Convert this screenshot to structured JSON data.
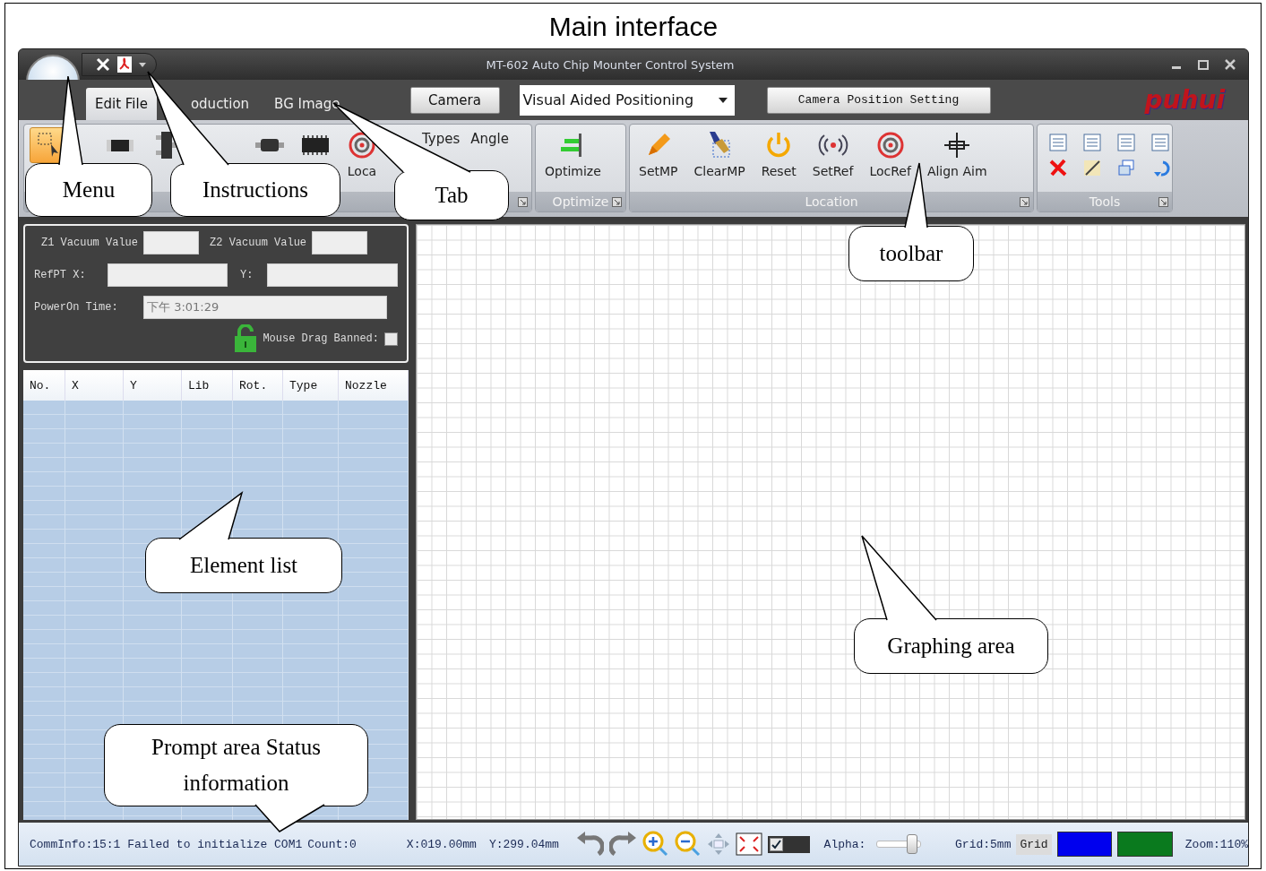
{
  "figure_title": "Main interface",
  "window": {
    "title": "MT-602 Auto Chip Mounter Control System"
  },
  "tabs": [
    {
      "label": "Edit File",
      "selected": true
    },
    {
      "label": "oduction",
      "selected": false
    },
    {
      "label": "BG Image",
      "selected": false
    }
  ],
  "tab_bar": {
    "camera_button": "Camera",
    "mode_select": "Visual Aided Positioning",
    "camera_position_button": "Camera Position Setting",
    "logo": "puhui"
  },
  "ribbon": [
    {
      "kind": "parts",
      "items": [
        {
          "kind": "select",
          "selected": true
        },
        {
          "kind": "chip",
          "selected": false
        },
        {
          "kind": "transistor",
          "selected": false
        },
        {
          "kind": "diode",
          "selected": false
        },
        {
          "kind": "ic",
          "selected": false
        },
        {
          "kind": "target",
          "label": "Loca",
          "selected": false
        }
      ],
      "fields": [
        {
          "label": "Types"
        },
        {
          "label": "Angle"
        }
      ]
    },
    {
      "kind": "buttons",
      "label": "Optimize",
      "items": [
        {
          "kind": "optimize",
          "label": "Optimize"
        }
      ]
    },
    {
      "kind": "buttons",
      "label": "Location",
      "items": [
        {
          "kind": "pencil",
          "label": "SetMP"
        },
        {
          "kind": "brush",
          "label": "ClearMP"
        },
        {
          "kind": "power",
          "label": "Reset"
        },
        {
          "kind": "signal",
          "label": "SetRef"
        },
        {
          "kind": "target",
          "label": "LocRef"
        },
        {
          "kind": "crosshair",
          "label": "Align Aim"
        }
      ]
    },
    {
      "kind": "tools",
      "label": "Tools",
      "items": [
        {
          "kind": "doc"
        },
        {
          "kind": "doc"
        },
        {
          "kind": "doc"
        },
        {
          "kind": "doc"
        },
        {
          "kind": "delete"
        },
        {
          "kind": "edit"
        },
        {
          "kind": "copy"
        },
        {
          "kind": "rotate"
        }
      ]
    }
  ],
  "info_panel": {
    "z1_label": "Z1 Vacuum Value",
    "z2_label": "Z2 Vacuum Value",
    "refpt_x_label": "RefPT X:",
    "refpt_y_label": "Y:",
    "poweron_label": "PowerOn Time:",
    "poweron_value": "下午 3:01:29",
    "mouse_drag": {
      "label": "Mouse Drag Banned:",
      "checked": false
    }
  },
  "element_table": {
    "columns": [
      "No.",
      "X",
      "Y",
      "Lib",
      "Rot.",
      "Type",
      "Nozzle"
    ]
  },
  "status_bar": {
    "comm_info": "CommInfo:15:1 Failed to initialize COM1",
    "count": "Count:0",
    "x": "X:019.00mm",
    "y": "Y:299.04mm",
    "show_checkbox": {
      "checked": true
    },
    "alpha_label": "Alpha:",
    "alpha": {
      "level": 0.8
    },
    "grid_info": "Grid:5mm",
    "grid_button": "Grid",
    "swatches": [
      {
        "color": "#0000ee"
      },
      {
        "color": "#0a7a1e"
      }
    ],
    "zoom": "Zoom:110%"
  },
  "callouts": [
    {
      "text": "Menu"
    },
    {
      "text": "Instructions"
    },
    {
      "text": "Tab"
    },
    {
      "text": "toolbar"
    },
    {
      "text": "Element list"
    },
    {
      "text": "Graphing area"
    },
    {
      "text": "Prompt area Status information"
    }
  ]
}
